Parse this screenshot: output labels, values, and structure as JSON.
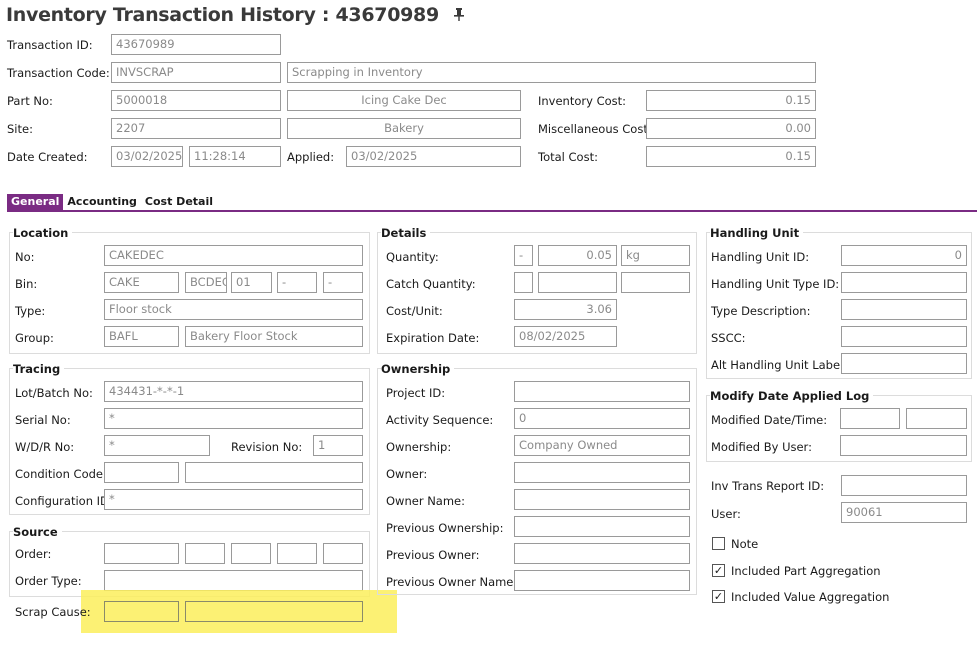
{
  "header": {
    "title": "Inventory Transaction History : 43670989",
    "pin_icon": "pin-icon"
  },
  "top": {
    "transaction_id_label": "Transaction ID:",
    "transaction_id": "43670989",
    "transaction_code_label": "Transaction Code:",
    "transaction_code": "INVSCRAP",
    "transaction_code_desc": "Scrapping in Inventory",
    "part_no_label": "Part No:",
    "part_no": "5000018",
    "part_desc": "Icing Cake Dec",
    "site_label": "Site:",
    "site": "2207",
    "site_desc": "Bakery",
    "date_created_label": "Date Created:",
    "date_created": "03/02/2025",
    "time_created": "11:28:14",
    "applied_label": "Applied:",
    "applied": "03/02/2025",
    "inventory_cost_label": "Inventory Cost:",
    "inventory_cost": "0.15",
    "misc_cost_label": "Miscellaneous Cost:",
    "misc_cost": "0.00",
    "total_cost_label": "Total Cost:",
    "total_cost": "0.15"
  },
  "tabs": [
    "General",
    "Accounting",
    "Cost Detail"
  ],
  "location": {
    "heading": "Location",
    "no_label": "No:",
    "no": "CAKEDEC",
    "bin_label": "Bin:",
    "bin1": "CAKE",
    "bin2": "BCDEC",
    "bin3": "01",
    "bin4": "-",
    "bin5": "-",
    "type_label": "Type:",
    "type": "Floor stock",
    "group_label": "Group:",
    "group": "BAFL",
    "group_desc": "Bakery Floor Stock"
  },
  "tracing": {
    "heading": "Tracing",
    "lot_label": "Lot/Batch No:",
    "lot": "434431-*-*-1",
    "serial_label": "Serial No:",
    "serial": "*",
    "wdr_label": "W/D/R No:",
    "wdr": "*",
    "revision_label": "Revision No:",
    "revision": "1",
    "condition_label": "Condition Code:",
    "config_label": "Configuration ID:",
    "config": "*"
  },
  "source": {
    "heading": "Source",
    "order_label": "Order:",
    "order_type_label": "Order Type:",
    "scrap_cause_label": "Scrap Cause:"
  },
  "details": {
    "heading": "Details",
    "quantity_label": "Quantity:",
    "quantity_sign": "-",
    "quantity": "0.05",
    "quantity_uom": "kg",
    "catch_qty_label": "Catch Quantity:",
    "cost_unit_label": "Cost/Unit:",
    "cost_unit": "3.06",
    "expiration_label": "Expiration Date:",
    "expiration": "08/02/2025"
  },
  "ownership": {
    "heading": "Ownership",
    "project_label": "Project ID:",
    "activity_label": "Activity Sequence:",
    "activity": "0",
    "ownership_label": "Ownership:",
    "ownership": "Company Owned",
    "owner_label": "Owner:",
    "owner_name_label": "Owner Name:",
    "prev_ownership_label": "Previous Ownership:",
    "prev_owner_label": "Previous Owner:",
    "prev_owner_name_label": "Previous Owner Name:"
  },
  "handling": {
    "heading": "Handling Unit",
    "hu_id_label": "Handling Unit ID:",
    "hu_id": "0",
    "hu_type_label": "Handling Unit Type ID:",
    "type_desc_label": "Type Description:",
    "sscc_label": "SSCC:",
    "alt_label": "Alt Handling Unit Label ID:"
  },
  "modify": {
    "heading": "Modify Date Applied Log",
    "modified_dt_label": "Modified Date/Time:",
    "modified_by_label": "Modified By User:"
  },
  "misc": {
    "report_label": "Inv Trans Report ID:",
    "user_label": "User:",
    "user": "90061",
    "note_label": "Note",
    "part_agg_label": "Included Part Aggregation",
    "value_agg_label": "Included Value Aggregation",
    "check_mark": "✓"
  }
}
